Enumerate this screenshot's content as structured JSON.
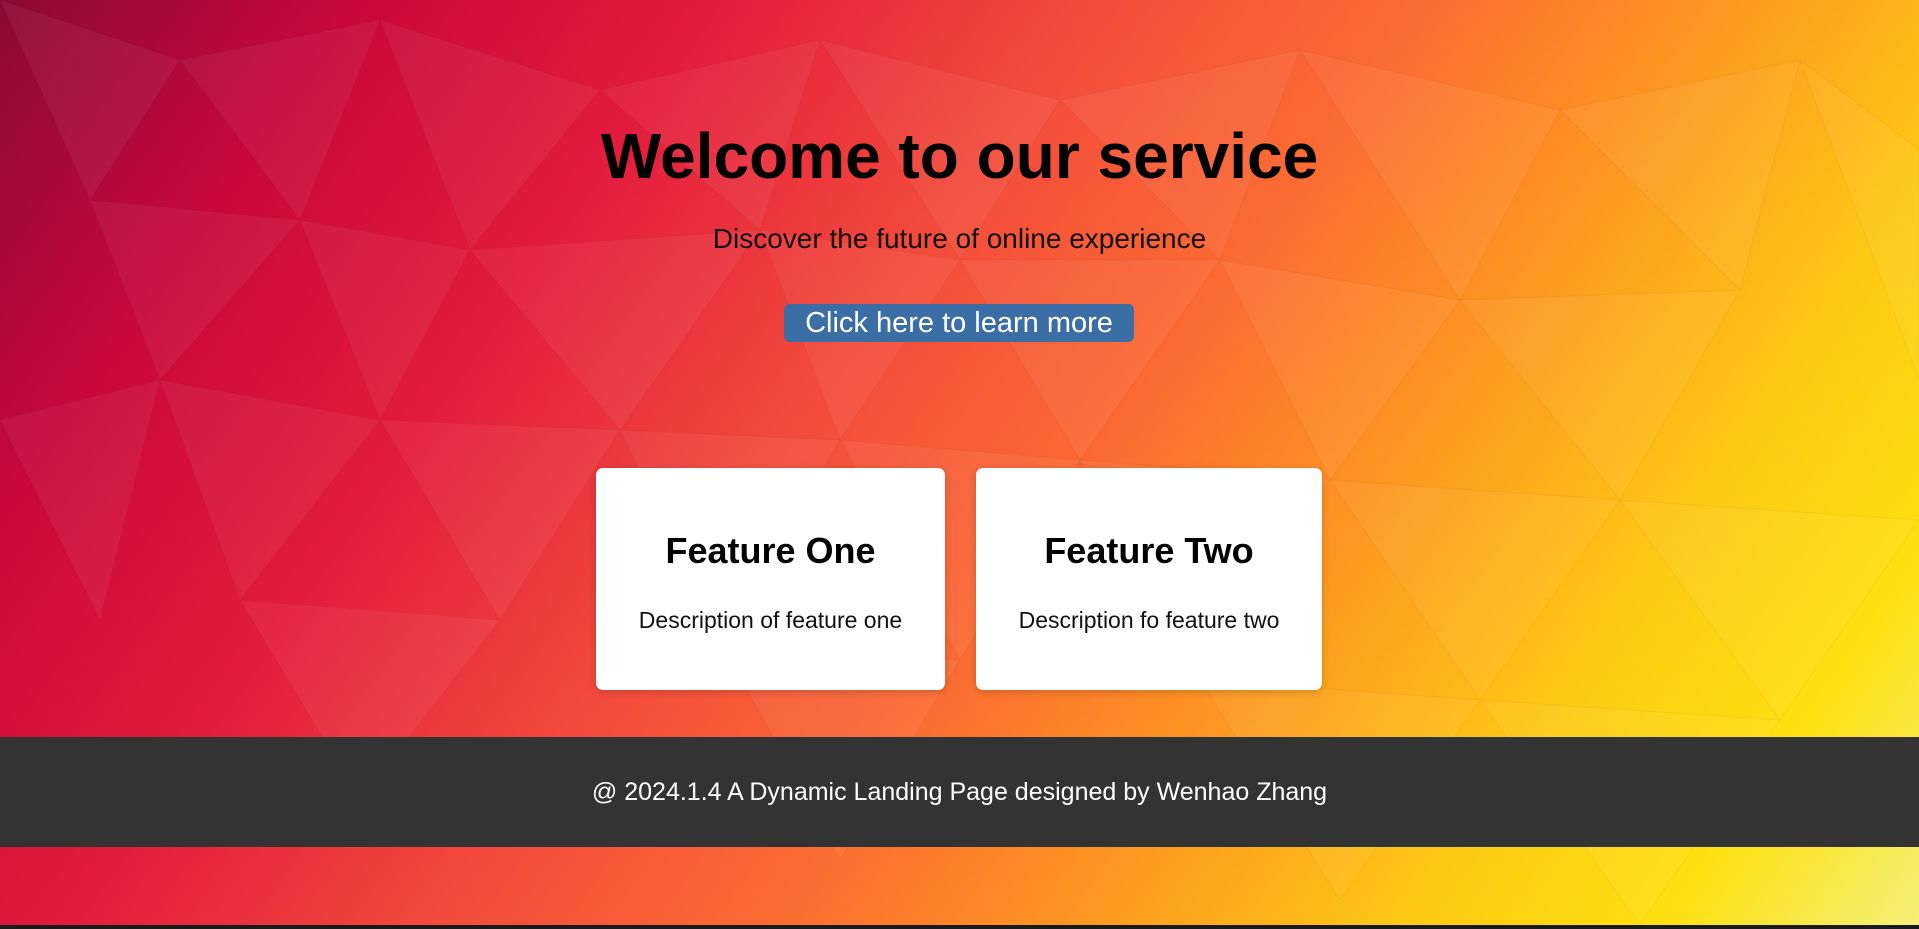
{
  "hero": {
    "title": "Welcome to our service",
    "subtitle": "Discover the future of online experience",
    "cta_label": "Click here to learn more"
  },
  "features": [
    {
      "title": "Feature One",
      "description": "Description of feature one"
    },
    {
      "title": "Feature Two",
      "description": "Description fo feature two"
    }
  ],
  "footer": {
    "text": "@ 2024.1.4 A Dynamic Landing Page designed by Wenhao Zhang"
  },
  "colors": {
    "cta_background": "#3a6ea5",
    "footer_background": "#333333",
    "card_background": "#ffffff",
    "gradient_start": "#8a0a35",
    "gradient_mid": "#f24a3c",
    "gradient_end": "#fde00f"
  }
}
